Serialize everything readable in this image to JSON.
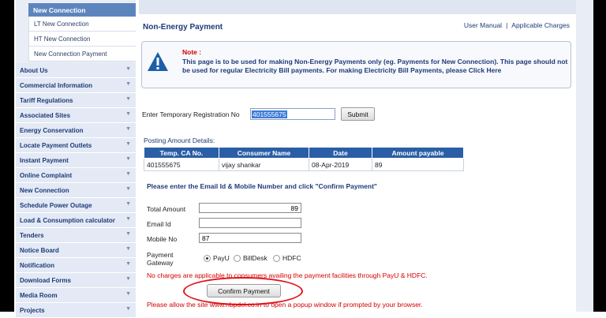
{
  "sidebar": {
    "submenu_title": "New Connection",
    "submenu_items": [
      "LT New Connection",
      "HT New Connection",
      "New Connection Payment"
    ],
    "menu_items": [
      "About Us",
      "Commercial Information",
      "Tariff Regulations",
      "Associated Sites",
      "Energy Conservation",
      "Locate Payment Outlets",
      "Instant Payment",
      "Online Complaint",
      "New Connection",
      "Schedule Power Outage",
      "Load & Consumption calculator",
      "Tenders",
      "Notice Board",
      "Notification",
      "Download Forms",
      "Media Room",
      "Projects"
    ]
  },
  "header": {
    "title": "Non-Energy Payment",
    "user_manual": "User Manual",
    "separator": "|",
    "applicable_charges": "Applicable Charges"
  },
  "note": {
    "title": "Note :",
    "text": "This page is to be used for making Non-Energy Payments only (eg. Payments for New Connection). This page should not be used for regular Electricity Bill payments. For making Electricity Bill Payments, please Click Here"
  },
  "registration": {
    "label": "Enter Temporary Registration No",
    "value": "401555675",
    "submit_label": "Submit"
  },
  "posting": {
    "label": "Posting Amount Details:",
    "headers": [
      "Temp. CA No.",
      "Consumer Name",
      "Date",
      "Amount payable"
    ],
    "row": [
      "401555675",
      "vijay shankar",
      "08-Apr-2019",
      "89"
    ]
  },
  "form": {
    "instruction": "Please enter the Email Id & Mobile Number and click \"Confirm Payment\"",
    "total_amount_label": "Total Amount",
    "total_amount_value": "89",
    "email_label": "Email Id",
    "email_value": "",
    "mobile_label": "Mobile No",
    "mobile_value": "87",
    "gateway_label": "Payment Gateway",
    "gateways": [
      "PayU",
      "BillDesk",
      "HDFC"
    ],
    "selected_gateway": "PayU",
    "charges_note": "No charges are applicable to consumers availing the payment facilities through PayU & HDFC.",
    "confirm_label": "Confirm Payment",
    "popup_note": "Please allow the site www.nbpdcl.co.in to open a popup window if prompted by your browser."
  },
  "colors": {
    "menu_text": "#1f3a78",
    "table_header": "#2a5ea6",
    "alert_red": "#d40000",
    "highlight": "#3b7ad6"
  }
}
